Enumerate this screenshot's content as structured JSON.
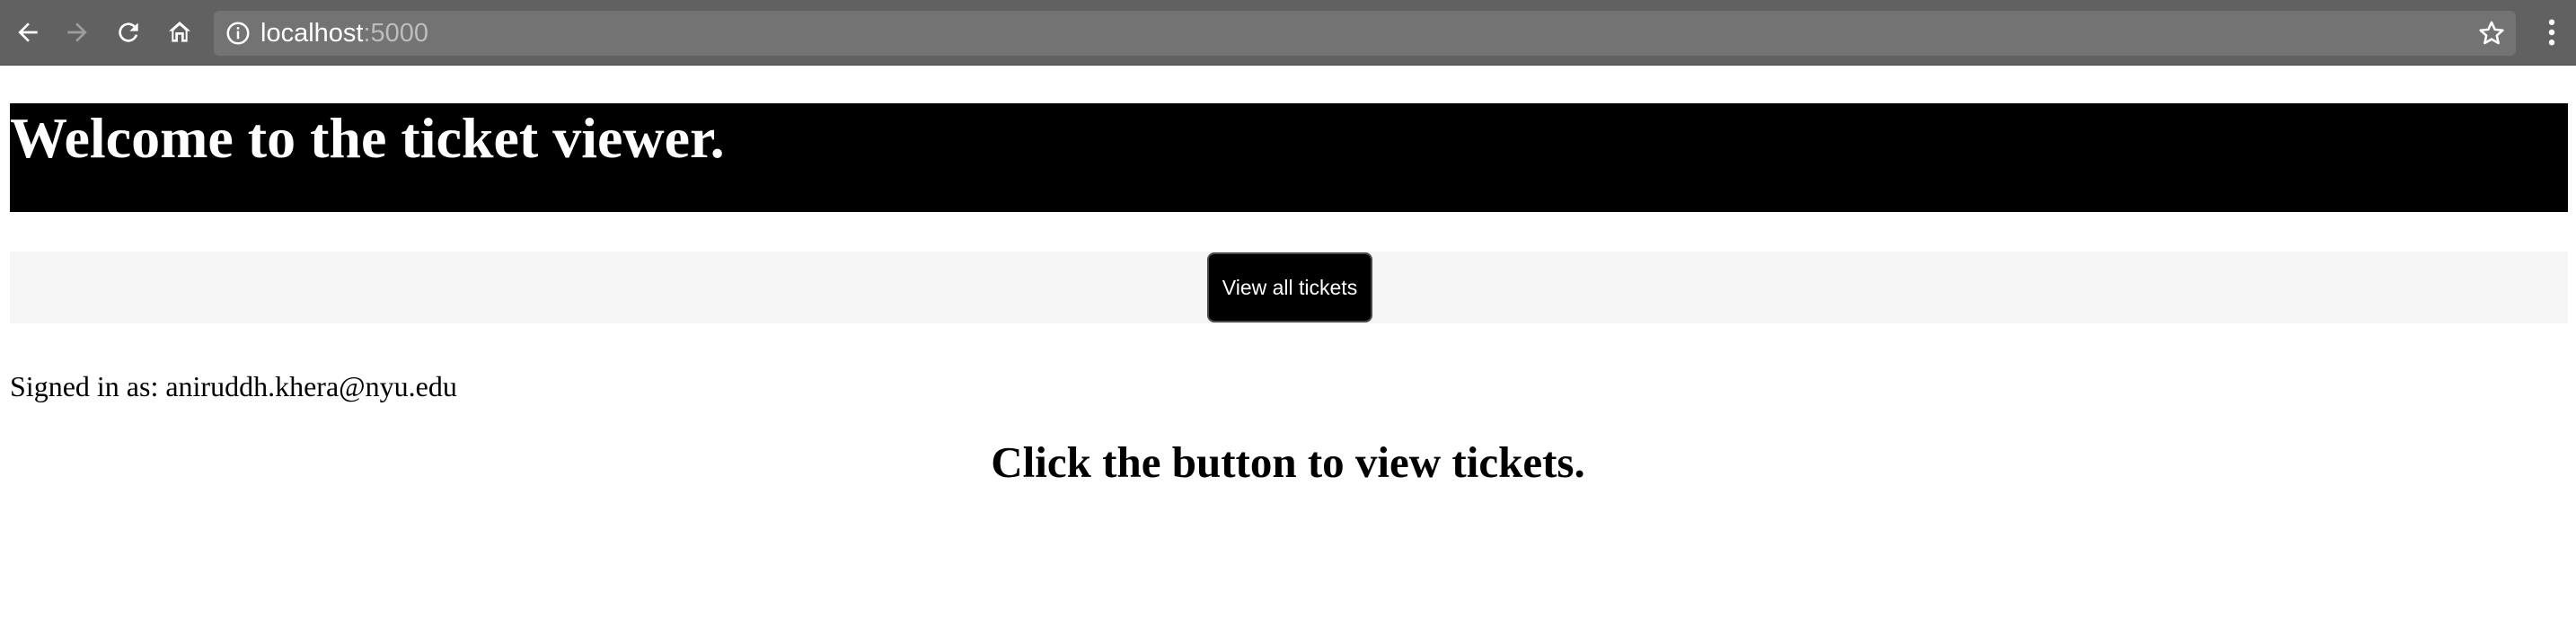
{
  "browser": {
    "url_host": "localhost",
    "url_port": ":5000",
    "icons": {
      "back": "back-arrow-icon",
      "forward": "forward-arrow-icon",
      "reload": "reload-icon",
      "home": "home-icon",
      "info": "info-icon",
      "bookmark": "star-icon",
      "menu": "kebab-menu-icon"
    }
  },
  "page": {
    "header_title": "Welcome to the ticket viewer.",
    "view_button_label": "View all tickets",
    "signed_in_text": "Signed in as: aniruddh.khera@nyu.edu",
    "prompt_text": "Click the button to view tickets."
  },
  "colors": {
    "chrome_bg": "#616161",
    "omnibox_bg": "#737373",
    "header_bg": "#000000",
    "action_bar_bg": "#f5f5f5",
    "button_bg": "#000000"
  }
}
